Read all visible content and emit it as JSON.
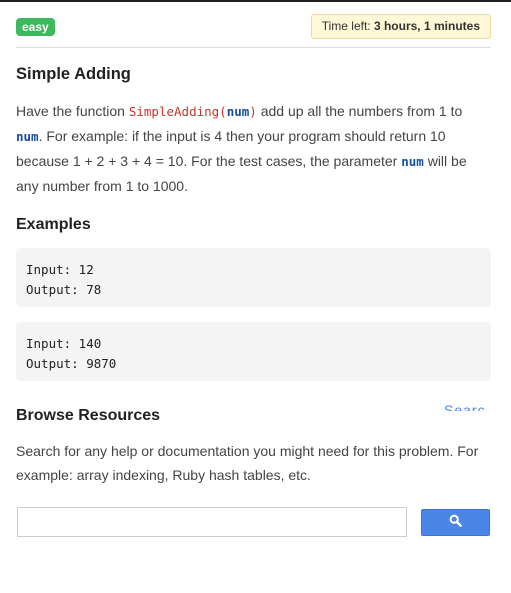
{
  "header": {
    "difficulty_badge": "easy",
    "timer_label": "Time left: ",
    "timer_value": "3 hours, 1 minutes"
  },
  "problem": {
    "title": "Simple Adding",
    "desc_1": "Have the function ",
    "function_code": "SimpleAdding(",
    "param_code": "num",
    "close_paren": ")",
    "desc_2": " add up all the numbers from 1 to ",
    "desc_3": ". For example: if the input is 4 then your program should return 10 because 1 + 2 + 3 + 4 = 10. For the test cases, the parameter ",
    "desc_4": " will be any number from 1 to 1000."
  },
  "examples": {
    "heading": "Examples",
    "items": [
      {
        "input_line": "Input: 12",
        "output_line": "Output: 78"
      },
      {
        "input_line": "Input: 140",
        "output_line": "Output: 9870"
      }
    ]
  },
  "resources": {
    "heading": "Browse Resources",
    "description": "Search for any help or documentation you might need for this problem. For example: array indexing, Ruby hash tables, etc.",
    "search_value": "",
    "partial_glyph": "Searc"
  },
  "colors": {
    "badge_green": "#3cb95c",
    "timer_bg": "#fff8d6",
    "function_red": "#c0392b",
    "param_blue": "#1a4fa0",
    "search_button_blue": "#4a86e8"
  },
  "icons": {
    "search_button": "search-icon"
  }
}
